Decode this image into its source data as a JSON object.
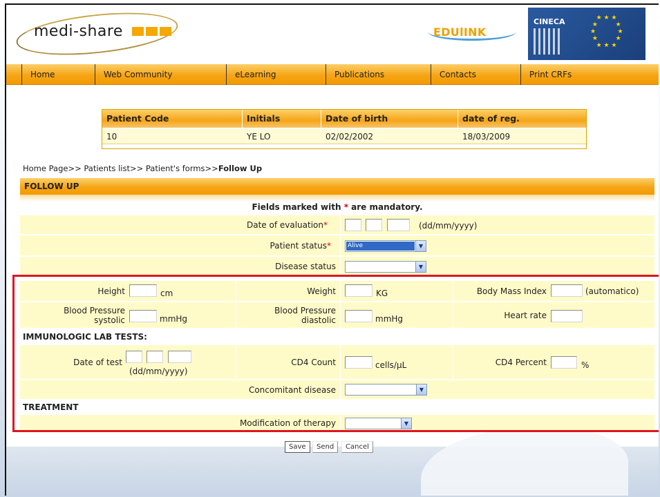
{
  "header": {
    "logo_text": "medi-share",
    "partner_logo_text": "EDUlINK",
    "cineca_text": "CINECA"
  },
  "nav": {
    "items": [
      "Home",
      "Web Community",
      "eLearning",
      "Publications",
      "Contacts",
      "Print CRFs"
    ]
  },
  "patient": {
    "headers": [
      "Patient Code",
      "Initials",
      "Date of birth",
      "date of reg."
    ],
    "values": [
      "10",
      "YE LO",
      "02/02/2002",
      "18/03/2009"
    ]
  },
  "breadcrumb": {
    "path": "Home Page>> Patients list>> Patient's forms>>",
    "current": "Follow Up"
  },
  "section": {
    "title": "FOLLOW UP",
    "mandatory_prefix": "Fields marked with ",
    "mandatory_star": "*",
    "mandatory_suffix": " are mandatory."
  },
  "form": {
    "date_of_evaluation_label": "Date of evaluation",
    "date_format": "(dd/mm/yyyy)",
    "patient_status_label": "Patient status",
    "patient_status_value": "Alive",
    "disease_status_label": "Disease status",
    "height_label": "Height",
    "height_unit": "cm",
    "weight_label": "Weight",
    "weight_unit": "KG",
    "bmi_label": "Body Mass Index",
    "bmi_note": "(automatico)",
    "bp_systolic_label_1": "Blood Pressure",
    "bp_systolic_label_2": "systolic",
    "bp_unit": "mmHg",
    "bp_diastolic_label_1": "Blood Pressure",
    "bp_diastolic_label_2": "diastolic",
    "heart_rate_label": "Heart rate",
    "immuno_title": "IMMUNOLOGIC LAB TESTS:",
    "date_of_test_label": "Date of test",
    "date_of_test_format": "(dd/mm/yyyy)",
    "cd4_count_label": "CD4 Count",
    "cd4_count_unit": "cells/µL",
    "cd4_percent_label": "CD4 Percent",
    "cd4_percent_unit": "%",
    "concomitant_label": "Concomitant disease",
    "treatment_title": "TREATMENT",
    "modification_label": "Modification of therapy"
  },
  "buttons": {
    "save": "Save",
    "send": "Send",
    "cancel": "Cancel"
  },
  "colors": {
    "accent_orange": "#f6a516",
    "row_yellow": "#fffbc8",
    "highlight_red": "#e0141e",
    "required_red": "#e00000",
    "selected_blue": "#3169c6"
  }
}
